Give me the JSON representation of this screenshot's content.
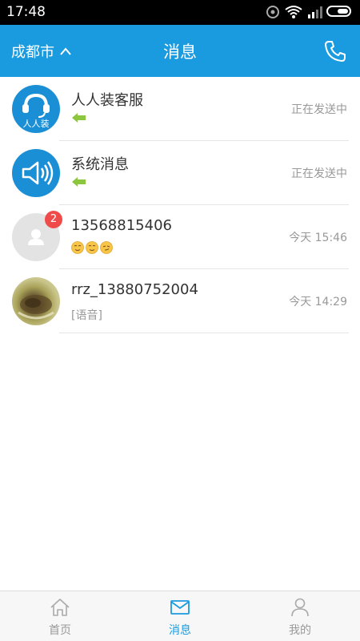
{
  "status_bar": {
    "time": "17:48"
  },
  "header": {
    "city": "成都市",
    "title": "消息"
  },
  "messages": [
    {
      "name": "人人装客服",
      "avatar_text": "人人装",
      "preview_icon": "green-arrow-icon",
      "time": "正在发送中"
    },
    {
      "name": "系统消息",
      "avatar_icon": "speaker-icon",
      "preview_icon": "green-arrow-icon",
      "time": "正在发送中"
    },
    {
      "name": "13568815406",
      "badge": "2",
      "preview_icon": "emoji-faces",
      "time": "今天  15:46"
    },
    {
      "name": "rrz_13880752004",
      "preview": "[语音]",
      "time": "今天  14:29"
    }
  ],
  "bottom_nav": [
    {
      "label": "首页",
      "icon": "home-icon"
    },
    {
      "label": "消息",
      "icon": "mail-icon",
      "active": true
    },
    {
      "label": "我的",
      "icon": "person-icon"
    }
  ],
  "colors": {
    "primary": "#1a9be0",
    "badge": "#f04b4b",
    "arrow_green": "#8cc63f"
  }
}
